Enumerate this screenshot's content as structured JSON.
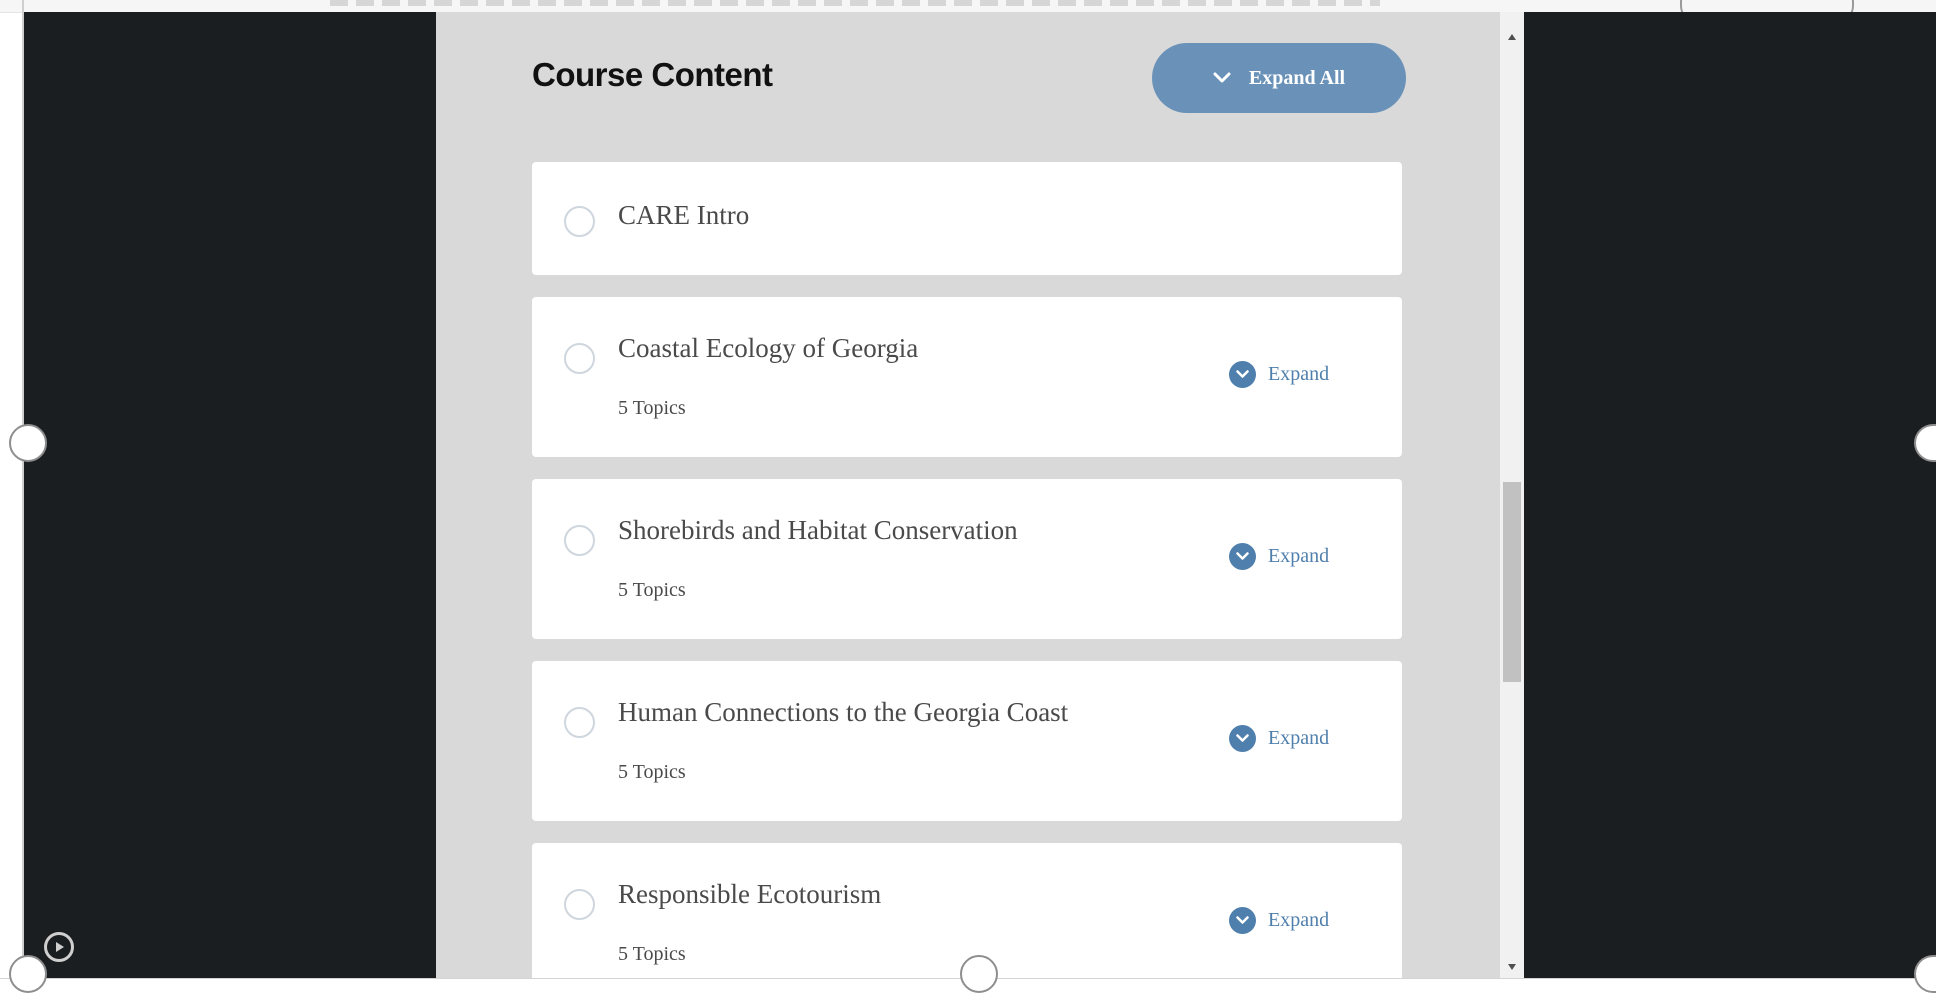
{
  "header": {
    "title": "Course Content",
    "expand_all_label": "Expand All"
  },
  "lessons": [
    {
      "title": "CARE Intro"
    },
    {
      "title": "Coastal Ecology of Georgia",
      "topics": "5 Topics",
      "expand_label": "Expand"
    },
    {
      "title": "Shorebirds and Habitat Conservation",
      "topics": "5 Topics",
      "expand_label": "Expand"
    },
    {
      "title": "Human Connections to the Georgia Coast",
      "topics": "5 Topics",
      "expand_label": "Expand"
    },
    {
      "title": "Responsible Ecotourism",
      "topics": "5 Topics",
      "expand_label": "Expand"
    }
  ],
  "colors": {
    "accent": "#6a92b8",
    "link": "#4f7fac",
    "frame_background": "#1b1e21",
    "content_background": "#d9d9d9"
  },
  "icons": {
    "expand_all": "chevron-down-icon",
    "expand": "chevron-down-circle-icon",
    "status": "radio-circle-icon",
    "media": "play-circle-icon"
  }
}
